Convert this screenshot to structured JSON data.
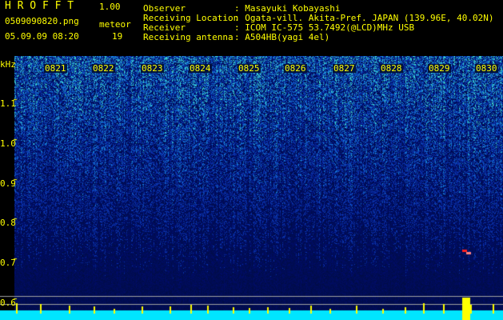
{
  "header": {
    "app_title": "H R O F F T",
    "version": "1.00",
    "filename": "0509090820.png",
    "meteor_label": "meteor",
    "datetime": "05.09.09 08:20",
    "meteor_count": "19",
    "info": [
      {
        "label": "Observer",
        "value": ": Masayuki Kobayashi"
      },
      {
        "label": "Receiving Location",
        "value": ": Ogata-vill. Akita-Pref. JAPAN (139.96E, 40.02N)"
      },
      {
        "label": "Receiver",
        "value": ": ICOM IC-575 53.7492(@LCD)MHz USB"
      },
      {
        "label": "Receiving antenna",
        "value": ": A504HB(yagi 4el)"
      }
    ]
  },
  "spectrogram": {
    "y_unit": "kHz",
    "y_ticks": [
      "1.1",
      "1.0",
      "0.9",
      "0.8",
      "0.7",
      "0.6"
    ],
    "time_labels": [
      "0821",
      "0822",
      "0823",
      "0824",
      "0825",
      "0826",
      "0827",
      "0828",
      "0829",
      "0830"
    ],
    "colors": {
      "label": "#ffff00",
      "noise_low": "#001060",
      "noise_high": "#33cccc",
      "meteor": "#ff2020",
      "baseline": "#00e5ff"
    }
  }
}
